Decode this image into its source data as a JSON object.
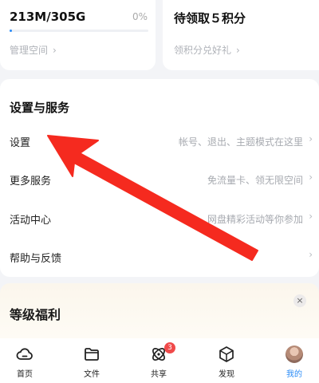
{
  "storage": {
    "value": "213M/305G",
    "percent": "0%",
    "used_fraction": 0.02,
    "manage_label": "管理空间"
  },
  "points": {
    "title": "待领取５积分",
    "subtitle": "领积分兑好礼"
  },
  "services": {
    "title": "设置与服务",
    "items": [
      {
        "label": "设置",
        "hint": "帐号、退出、主题模式在这里"
      },
      {
        "label": "更多服务",
        "hint": "免流量卡、领无限空间"
      },
      {
        "label": "活动中心",
        "hint": "网盘精彩活动等你参加"
      },
      {
        "label": "帮助与反馈",
        "hint": ""
      }
    ]
  },
  "level": {
    "title": "等级福利",
    "close": "×"
  },
  "nav": {
    "items": [
      {
        "label": "首页",
        "icon": "cloud-icon"
      },
      {
        "label": "文件",
        "icon": "folder-icon"
      },
      {
        "label": "共享",
        "icon": "share-icon",
        "badge": "3"
      },
      {
        "label": "发现",
        "icon": "cube-icon"
      },
      {
        "label": "我的",
        "icon": "avatar"
      }
    ],
    "active_color": "#2b8cf7"
  },
  "colors": {
    "accent": "#2b8cf7",
    "arrow": "#f52a1f",
    "badge": "#f04a4a"
  }
}
